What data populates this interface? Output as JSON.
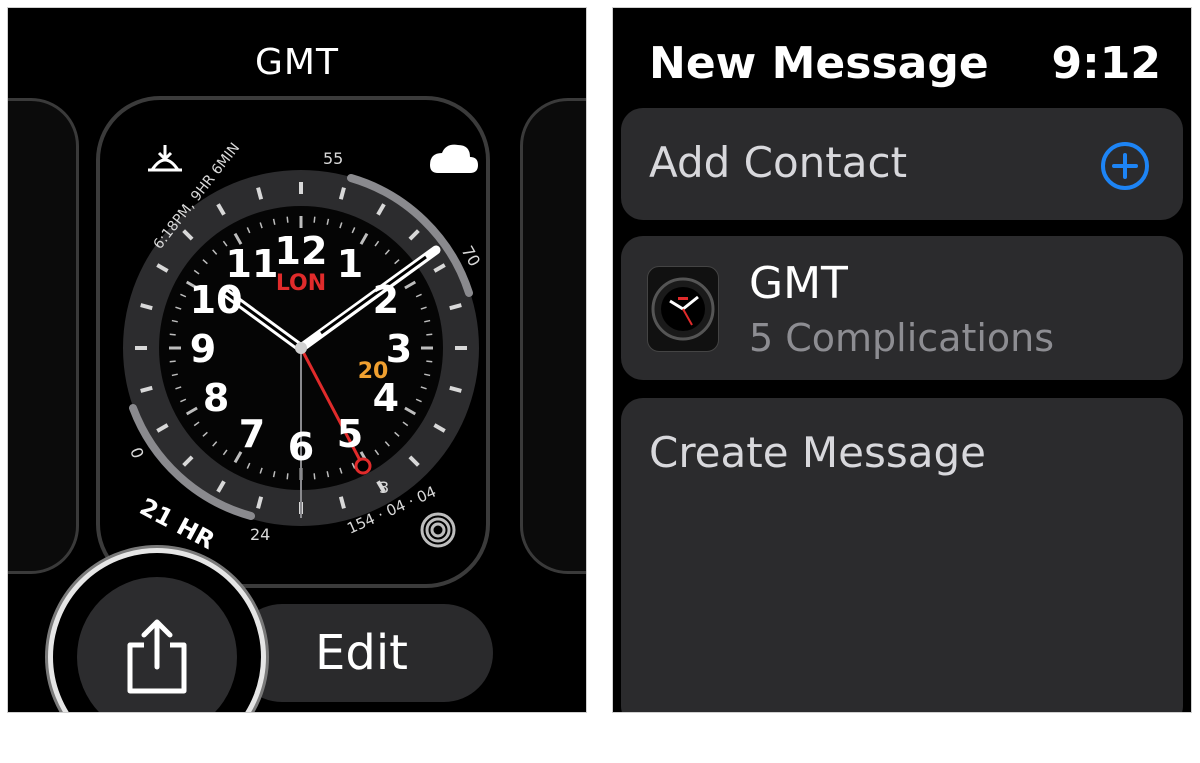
{
  "left": {
    "face_title": "GMT",
    "dial": {
      "hour_numbers": [
        "12",
        "1",
        "2",
        "3",
        "4",
        "5",
        "6",
        "7",
        "8",
        "9",
        "10",
        "11"
      ],
      "city": "LON",
      "gmt_marker": "20",
      "sunrise_text": "6:18PM, 9HR 6MIN",
      "weather_gauge": {
        "low": "55",
        "high": "70"
      },
      "hr_gauge": {
        "value": "21 HR",
        "min": "0",
        "max": "24"
      },
      "bottom_right_text": "154 · 04 · 04",
      "bezel_label": "3"
    },
    "edit_label": "Edit",
    "colors": {
      "accent_red": "#e02b2b",
      "accent_orange": "#f0a030"
    }
  },
  "right": {
    "title": "New Message",
    "time": "9:12",
    "add_contact_label": "Add Contact",
    "face_name": "GMT",
    "face_sub": "5 Complications",
    "create_message_label": "Create Message",
    "colors": {
      "accent_blue": "#1d84f5"
    }
  }
}
